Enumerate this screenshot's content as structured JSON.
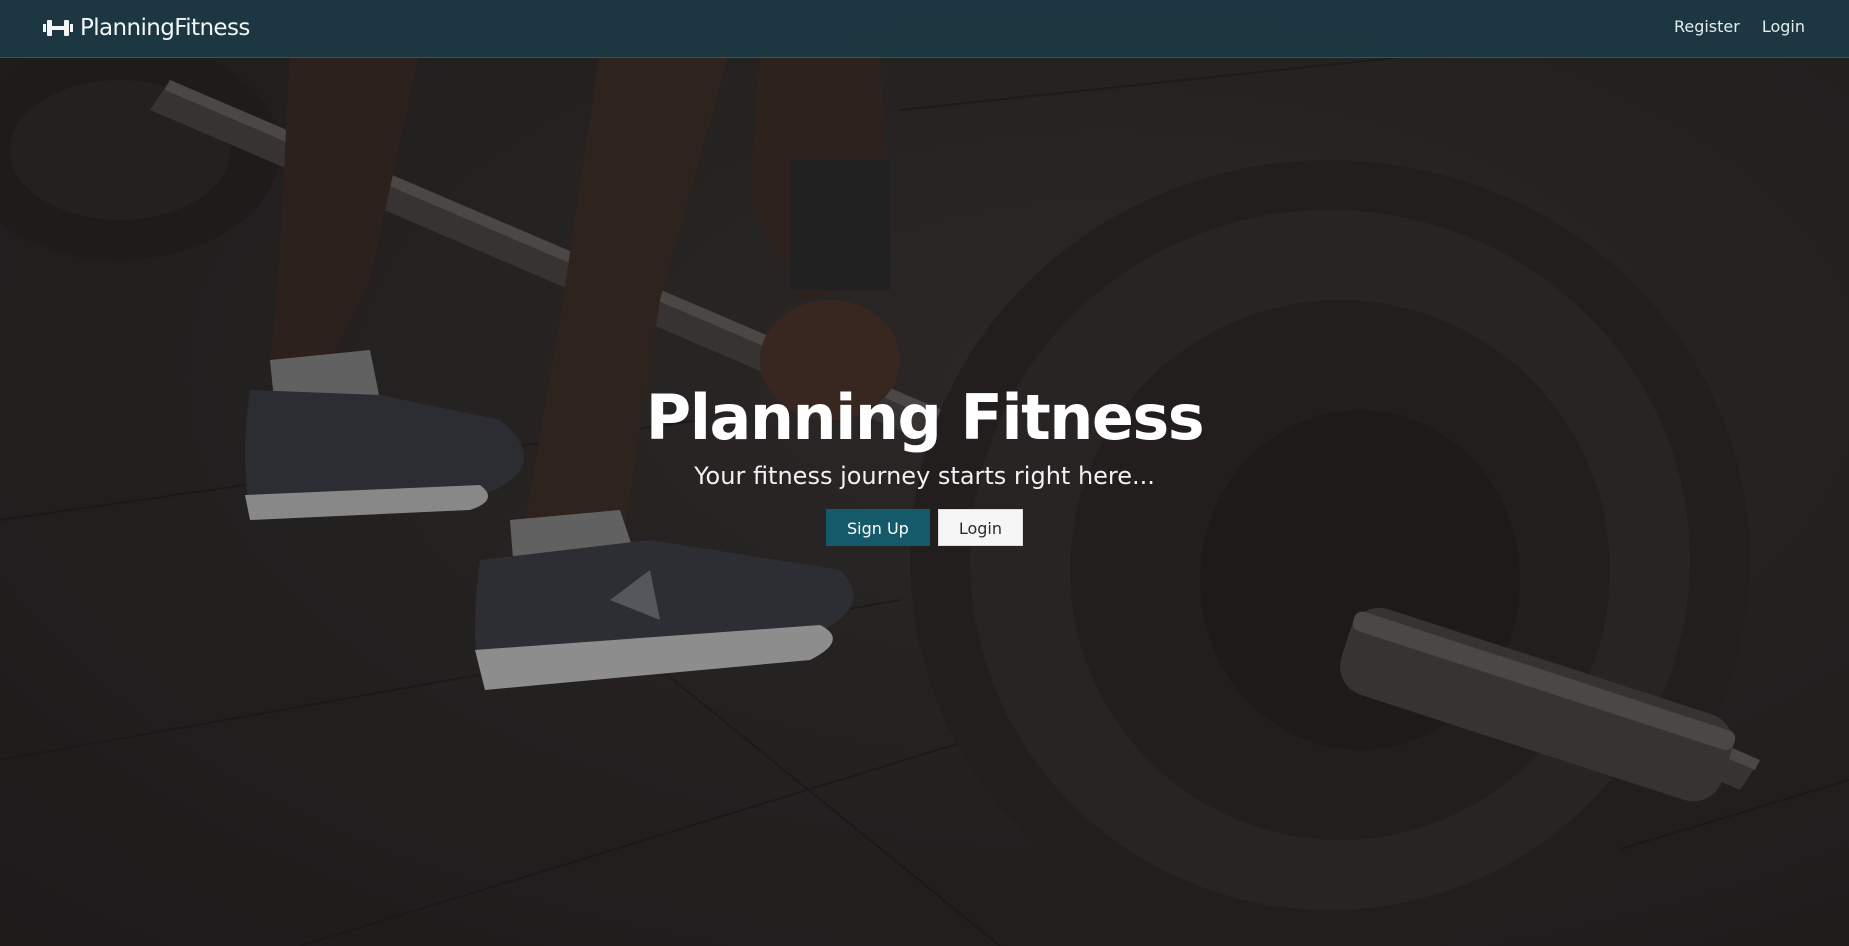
{
  "navbar": {
    "brand_text": "PlanningFitness",
    "brand_icon": "dumbbell-icon",
    "links": {
      "register": "Register",
      "login": "Login"
    }
  },
  "hero": {
    "title": "Planning Fitness",
    "subtitle": "Your fitness journey starts right here...",
    "buttons": {
      "signup": "Sign Up",
      "login": "Login"
    }
  },
  "colors": {
    "navbar_bg": "#1c3a44",
    "primary_button": "#155a6b",
    "secondary_button": "#f6f6f6"
  }
}
